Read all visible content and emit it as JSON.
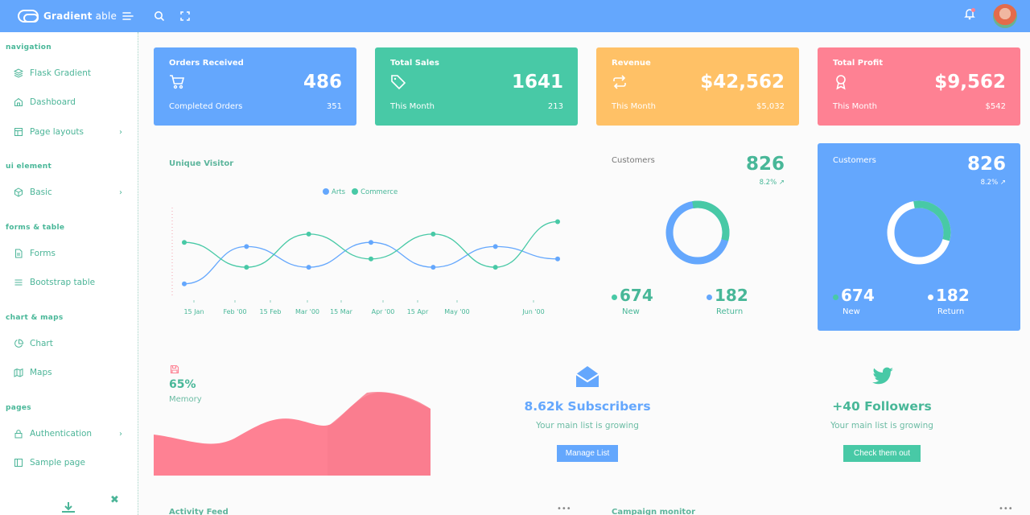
{
  "header": {
    "brand_name": "Gradient",
    "brand_suffix": " able",
    "icons": [
      "menu-icon",
      "search-icon",
      "fullscreen-icon",
      "bell-icon",
      "user-avatar"
    ]
  },
  "sidebar": {
    "captions": {
      "navigation": "navigation",
      "ui_element": "ui element",
      "forms_table": "forms & table",
      "chart_maps": "chart & maps",
      "pages": "pages"
    },
    "items": [
      {
        "label": "Flask Gradient",
        "icon": "layers-icon"
      },
      {
        "label": "Dashboard",
        "icon": "home-icon"
      },
      {
        "label": "Page layouts",
        "icon": "layout-icon",
        "chevron": "›"
      },
      {
        "label": "Basic",
        "icon": "box-icon",
        "chevron": "›"
      },
      {
        "label": "Forms",
        "icon": "file-icon"
      },
      {
        "label": "Bootstrap table",
        "icon": "list-icon"
      },
      {
        "label": "Chart",
        "icon": "pie-chart-icon"
      },
      {
        "label": "Maps",
        "icon": "map-icon"
      },
      {
        "label": "Authentication",
        "icon": "lock-icon",
        "chevron": "›"
      },
      {
        "label": "Sample page",
        "icon": "sidebar-icon"
      }
    ],
    "close_symbol": "✖"
  },
  "stats": [
    {
      "title": "Orders Received",
      "value": "486",
      "sub_label": "Completed Orders",
      "sub_value": "351",
      "icon": "cart-icon",
      "color": "#64a7fd"
    },
    {
      "title": "Total Sales",
      "value": "1641",
      "sub_label": "This Month",
      "sub_value": "213",
      "icon": "tag-icon",
      "color": "#48c9a6"
    },
    {
      "title": "Revenue",
      "value": "$42,562",
      "sub_label": "This Month",
      "sub_value": "$5,032",
      "icon": "repeat-icon",
      "color": "#ffc166"
    },
    {
      "title": "Total Profit",
      "value": "$9,562",
      "sub_label": "This Month",
      "sub_value": "$542",
      "icon": "award-icon",
      "color": "#fe8193"
    }
  ],
  "visitor": {
    "title": "Unique Visitor",
    "legend": [
      "Arts",
      "Commerce"
    ]
  },
  "chart_data": {
    "type": "line",
    "title": "Unique Visitor",
    "x": [
      "15 Jan",
      "Feb '00",
      "15 Feb",
      "Mar '00",
      "15 Mar",
      "Apr '00",
      "15 Apr",
      "May '00",
      "Jun '00"
    ],
    "point_index": [
      0,
      1,
      2,
      3,
      4,
      5,
      6
    ],
    "series": [
      {
        "name": "Arts",
        "color": "#64a7fd",
        "values": [
          10,
          55,
          30,
          60,
          30,
          55,
          40
        ]
      },
      {
        "name": "Commerce",
        "color": "#48c9a6",
        "values": [
          60,
          30,
          70,
          40,
          70,
          30,
          85
        ]
      }
    ],
    "ylim": [
      0,
      100
    ],
    "grid": false,
    "legend_position": "top"
  },
  "customers_white": {
    "title": "Customers",
    "total": "826",
    "pct": "8.2%",
    "trend_symbol": "↗",
    "new_value": "674",
    "new_label": "New",
    "return_value": "182",
    "return_label": "Return",
    "new_fraction": 0.32
  },
  "customers_blue": {
    "title": "Customers",
    "total": "826",
    "pct": "8.2%",
    "trend_symbol": "↗",
    "new_value": "674",
    "new_label": "New",
    "return_value": "182",
    "return_label": "Return",
    "new_fraction": 0.32
  },
  "memory": {
    "percent": "65%",
    "label": "Memory",
    "fill_fraction": 0.65,
    "icon": "save-icon"
  },
  "subscribers": {
    "headline": "8.62k Subscribers",
    "desc": "Your main list is growing",
    "button": "Manage List",
    "icon": "mail-open-icon"
  },
  "followers": {
    "headline": "+40 Followers",
    "desc": "Your main list is growing",
    "button": "Check them out",
    "icon": "twitter-icon"
  },
  "peek": {
    "activity": "Activity Feed",
    "campaign": "Campaign monitor"
  }
}
